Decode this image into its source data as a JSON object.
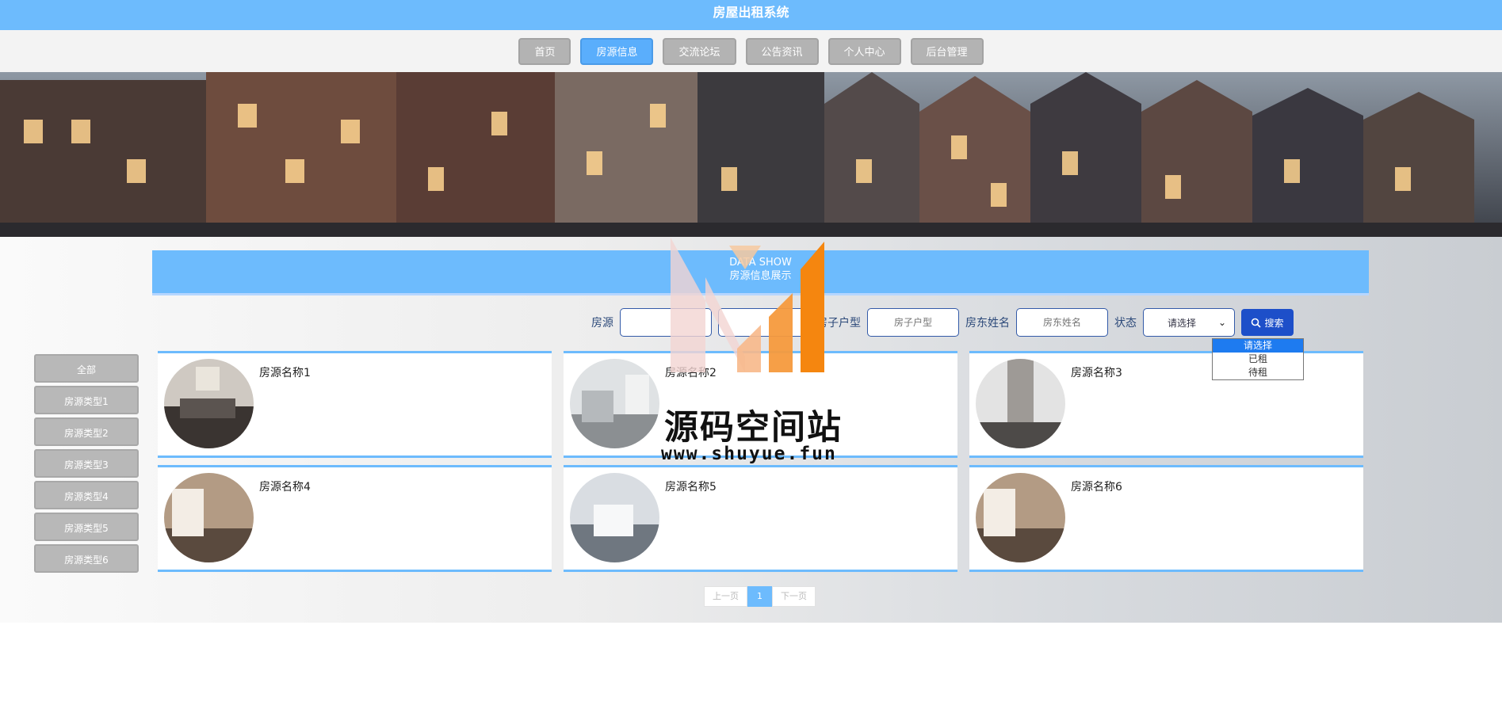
{
  "header": {
    "title": "房屋出租系统"
  },
  "nav": {
    "items": [
      {
        "label": "首页"
      },
      {
        "label": "房源信息"
      },
      {
        "label": "交流论坛"
      },
      {
        "label": "公告资讯"
      },
      {
        "label": "个人中心"
      },
      {
        "label": "后台管理"
      }
    ],
    "active_index": 1
  },
  "section": {
    "title_en": "DATA SHOW",
    "title_cn": "房源信息展示"
  },
  "search": {
    "name_label": "房源",
    "name_placeholder": "",
    "type_placeholder": "",
    "huxing_label": "房子户型",
    "huxing_placeholder": "房子户型",
    "landlord_label": "房东姓名",
    "landlord_placeholder": "房东姓名",
    "status_label": "状态",
    "status_value": "请选择",
    "status_options": [
      "请选择",
      "已租",
      "待租"
    ],
    "button_label": "搜索"
  },
  "sidebar": {
    "items": [
      {
        "label": "全部"
      },
      {
        "label": "房源类型1"
      },
      {
        "label": "房源类型2"
      },
      {
        "label": "房源类型3"
      },
      {
        "label": "房源类型4"
      },
      {
        "label": "房源类型5"
      },
      {
        "label": "房源类型6"
      }
    ]
  },
  "listings": [
    {
      "name": "房源名称1"
    },
    {
      "name": "房源名称2"
    },
    {
      "name": "房源名称3"
    },
    {
      "name": "房源名称4"
    },
    {
      "name": "房源名称5"
    },
    {
      "name": "房源名称6"
    }
  ],
  "pager": {
    "prev": "上一页",
    "current": "1",
    "next": "下一页"
  },
  "watermark": {
    "line1": "源码空间站",
    "line2": "www.shuyue.fun"
  },
  "colors": {
    "primary": "#6dbbfd",
    "search_button": "#1d4fc9",
    "nav_inactive": "#b3b3b3"
  }
}
